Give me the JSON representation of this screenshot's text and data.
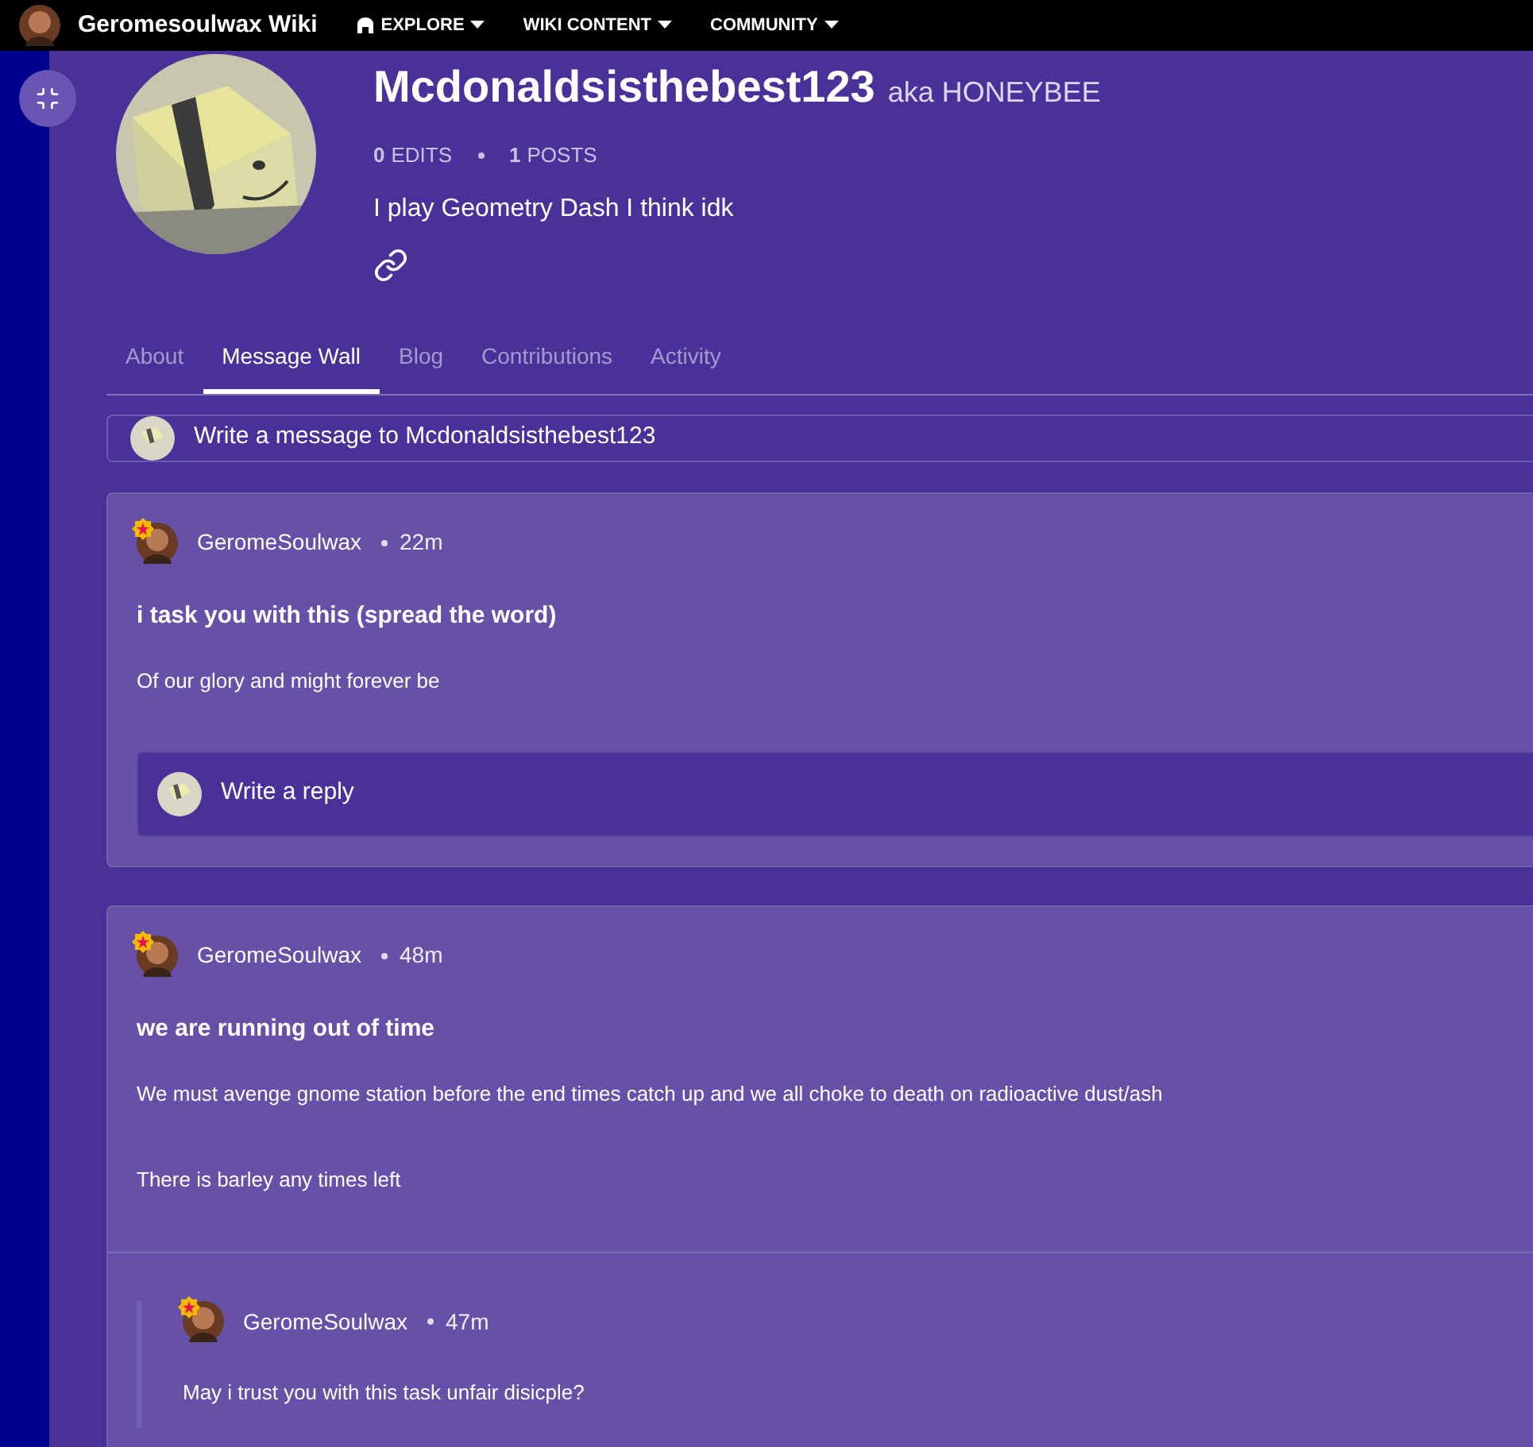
{
  "header": {
    "wiki_name": "Geromesoulwax Wiki",
    "nav": [
      {
        "label": "EXPLORE",
        "has_icon": true
      },
      {
        "label": "WIKI CONTENT",
        "has_icon": false
      },
      {
        "label": "COMMUNITY",
        "has_icon": false
      }
    ]
  },
  "profile": {
    "username": "Mcdonaldsisthebest123",
    "aka": "aka HONEYBEE",
    "stats": [
      {
        "count": "0",
        "label": "EDITS"
      },
      {
        "count": "1",
        "label": "POSTS"
      }
    ],
    "bio": "I play Geometry Dash I think idk"
  },
  "tabs": [
    {
      "label": "About",
      "selected": false
    },
    {
      "label": "Message Wall",
      "selected": true
    },
    {
      "label": "Blog",
      "selected": false
    },
    {
      "label": "Contributions",
      "selected": false
    },
    {
      "label": "Activity",
      "selected": false
    }
  ],
  "composer": {
    "placeholder": "Write a message to Mcdonaldsisthebest123"
  },
  "threads": [
    {
      "author": "GeromeSoulwax",
      "time": "22m",
      "title": "i task you with this (spread the word)",
      "paragraphs": [
        "Of our glory and might forever be"
      ],
      "reply_placeholder": "Write a reply"
    },
    {
      "author": "GeromeSoulwax",
      "time": "48m",
      "title": "we are running out of time",
      "paragraphs": [
        "We must avenge gnome station before the end times catch up and we all choke to death on radioactive dust/ash",
        "There is barley any times left"
      ],
      "replies": [
        {
          "author": "GeromeSoulwax",
          "time": "47m",
          "text": "May i trust you with this task unfair disicple?"
        }
      ]
    }
  ]
}
